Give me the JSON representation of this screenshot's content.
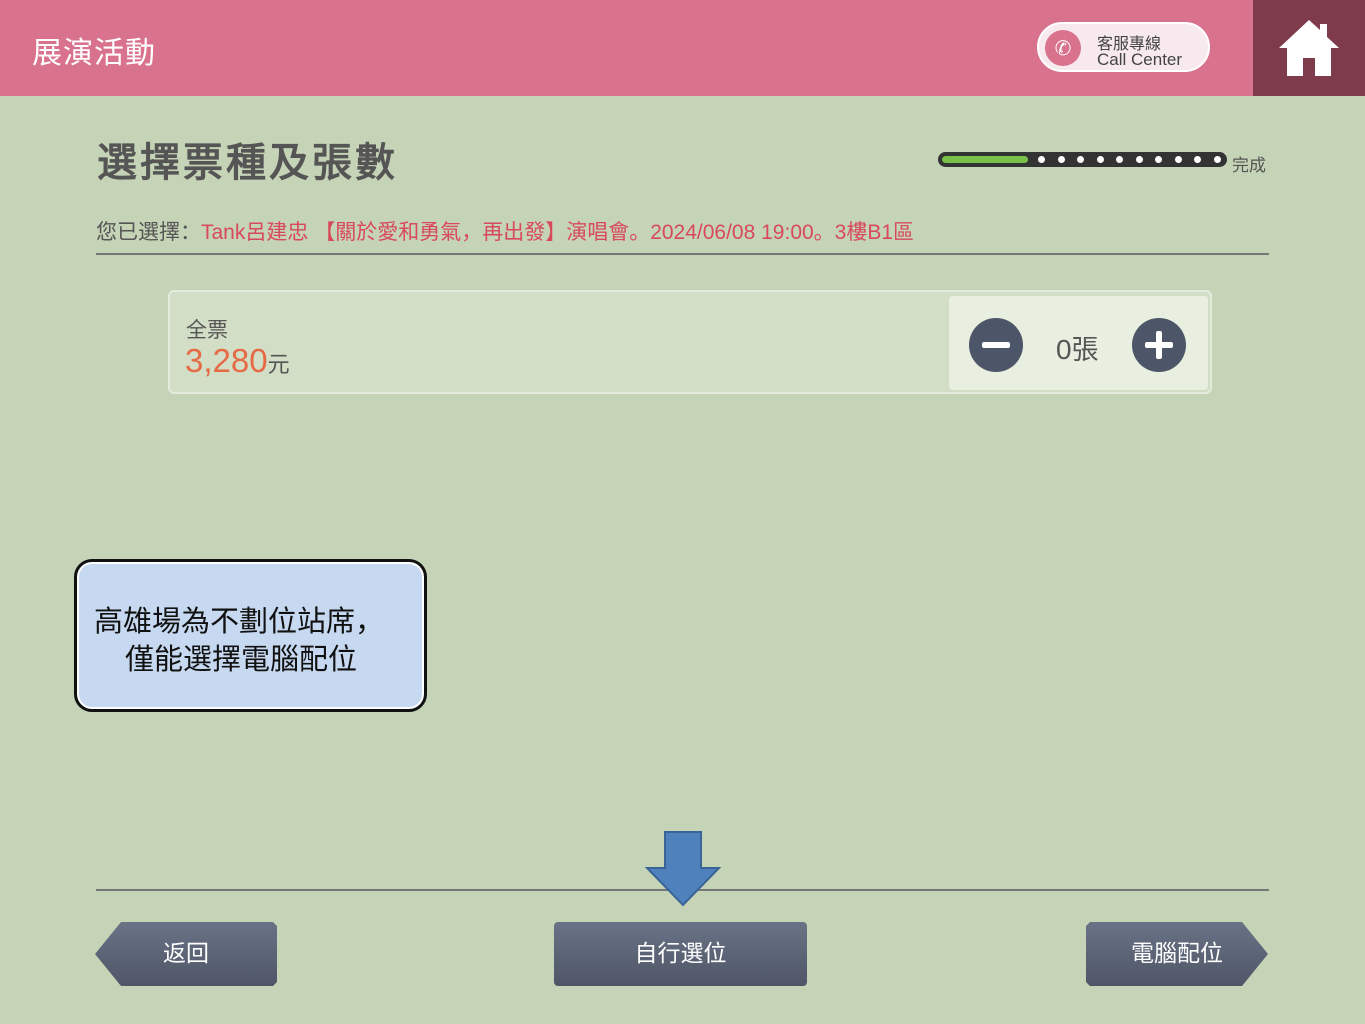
{
  "header": {
    "title": "展演活動",
    "call_center": {
      "line1": "客服專線",
      "line2": "Call Center"
    }
  },
  "page": {
    "title": "選擇票種及張數",
    "progress": {
      "label": "完成",
      "fraction": 0.3,
      "steps": 10
    }
  },
  "selection": {
    "prefix": "您已選擇：",
    "value": "Tank呂建忠 【關於愛和勇氣，再出發】演唱會。2024/06/08 19:00。3樓B1區"
  },
  "ticket": {
    "name": "全票",
    "price": "3,280",
    "currency": "元",
    "quantity": "0",
    "quantity_unit": "張"
  },
  "callout": {
    "line1": "高雄場為不劃位站席，",
    "line2": "僅能選擇電腦配位"
  },
  "nav": {
    "back": "返回",
    "self_select": "自行選位",
    "auto_assign": "電腦配位"
  },
  "colors": {
    "header": "#d9728c",
    "home": "#7d3b4c",
    "background": "#c5d4b6",
    "accent_red": "#d8495c",
    "price": "#e56a45",
    "button": "#596274",
    "arrow": "#4f81bd"
  }
}
